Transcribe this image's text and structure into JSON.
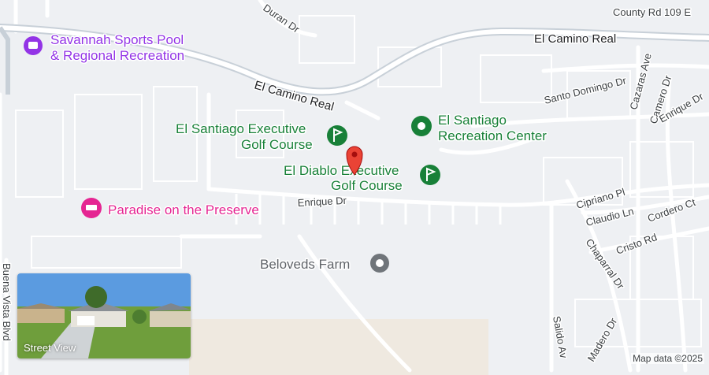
{
  "map": {
    "roads": {
      "county_rd": "County Rd 109 E",
      "el_camino_real_east": "El Camino Real",
      "el_camino_real_west": "El Camino Real",
      "duran": "Duran Dr",
      "santo_domingo": "Santo Domingo Dr",
      "cazaras": "Cazaras Ave",
      "camero": "Camero Dr",
      "enrique_east": "Enrique Dr",
      "enrique": "Enrique Dr",
      "cipriano": "Cipriano Pl",
      "claudio": "Claudio Ln",
      "cordero": "Cordero Ct",
      "cristo": "Cristo Rd",
      "chaparral": "Chaparral Dr",
      "buena_vista": "Buena Vista Blvd",
      "salido": "Salido Av",
      "madero": "Madero Dr"
    },
    "places": {
      "savannah_line1": "Savannah Sports Pool",
      "savannah_line2": "& Regional Recreation",
      "santiago_golf_line1": "El Santiago Executive",
      "santiago_golf_line2": "Golf Course",
      "santiago_rec_line1": "El Santiago",
      "santiago_rec_line2": "Recreation Center",
      "diablo_line1": "El Diablo Executive",
      "diablo_line2": "Golf Course",
      "paradise": "Paradise on the Preserve",
      "beloveds": "Beloveds Farm"
    },
    "street_view_label": "Street View",
    "attribution": "Map data ©2025",
    "colors": {
      "background": "#eef0f3",
      "road": "#ffffff",
      "highway": "#c8d0d8",
      "pin": "#ea4335",
      "golf": "#188038",
      "recreation": "#9334e6",
      "lodging": "#e52592"
    }
  }
}
